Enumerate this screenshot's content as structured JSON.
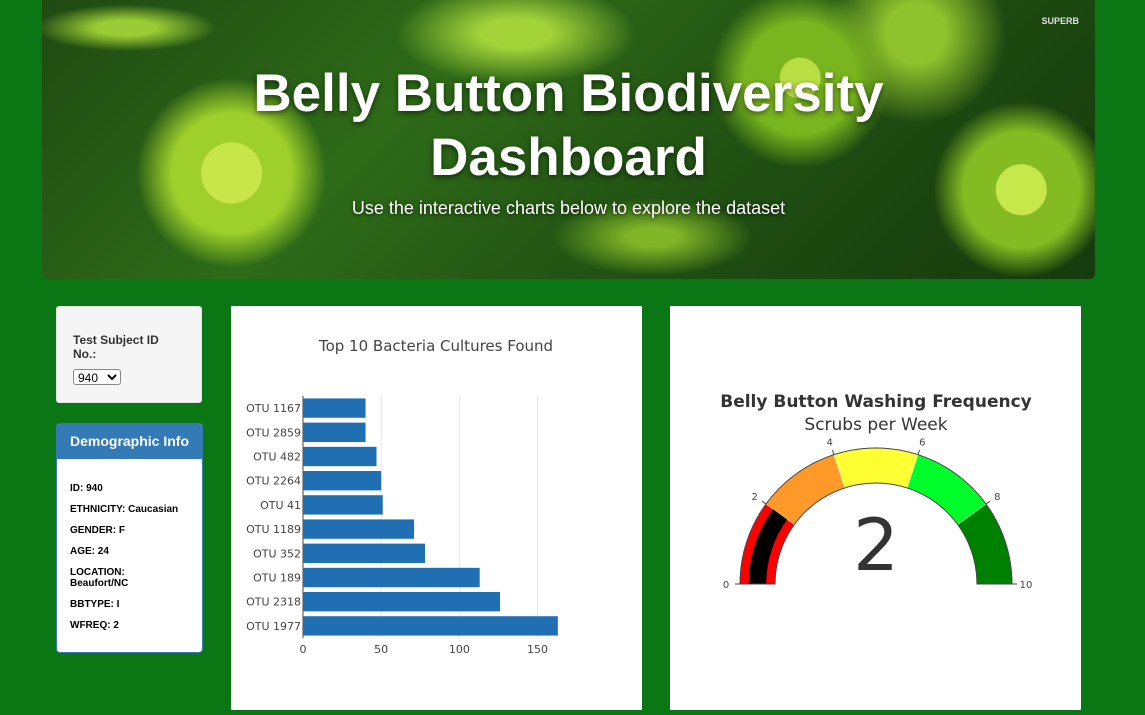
{
  "header": {
    "title_line1": "Belly Button Biodiversity",
    "title_line2": "Dashboard",
    "subtitle": "Use the interactive charts below to explore the dataset",
    "logo_text": "SUPERB"
  },
  "selector": {
    "label": "Test Subject ID No.:",
    "selected": "940"
  },
  "demographics": {
    "heading": "Demographic Info",
    "rows": [
      "ID: 940",
      "ETHNICITY: Caucasian",
      "GENDER: F",
      "AGE: 24",
      "LOCATION: Beaufort/NC",
      "BBTYPE: I",
      "WFREQ: 2"
    ]
  },
  "chart_data": [
    {
      "type": "bar",
      "orientation": "horizontal",
      "title": "Top 10 Bacteria Cultures Found",
      "categories": [
        "OTU 1167",
        "OTU 2859",
        "OTU 482",
        "OTU 2264",
        "OTU 41",
        "OTU 1189",
        "OTU 352",
        "OTU 189",
        "OTU 2318",
        "OTU 1977"
      ],
      "values": [
        40,
        40,
        47,
        50,
        51,
        71,
        78,
        113,
        126,
        163
      ],
      "xlim": [
        0,
        165
      ],
      "xticks": [
        0,
        50,
        100,
        150
      ],
      "color": "#1f6fb2",
      "grid": "vertical"
    },
    {
      "type": "gauge",
      "title": "Belly Button Washing Frequency",
      "subtitle": "Scrubs per Week",
      "value": 2,
      "range": [
        0,
        10
      ],
      "ticks": [
        0,
        2,
        4,
        6,
        8,
        10
      ],
      "steps": [
        {
          "range": [
            0,
            2
          ],
          "color": "#ff0000"
        },
        {
          "range": [
            2,
            4
          ],
          "color": "#ff9a28"
        },
        {
          "range": [
            4,
            6
          ],
          "color": "#ffff33"
        },
        {
          "range": [
            6,
            8
          ],
          "color": "#00ff2a"
        },
        {
          "range": [
            8,
            10
          ],
          "color": "#008000"
        }
      ],
      "bar_color": "#000000"
    }
  ]
}
